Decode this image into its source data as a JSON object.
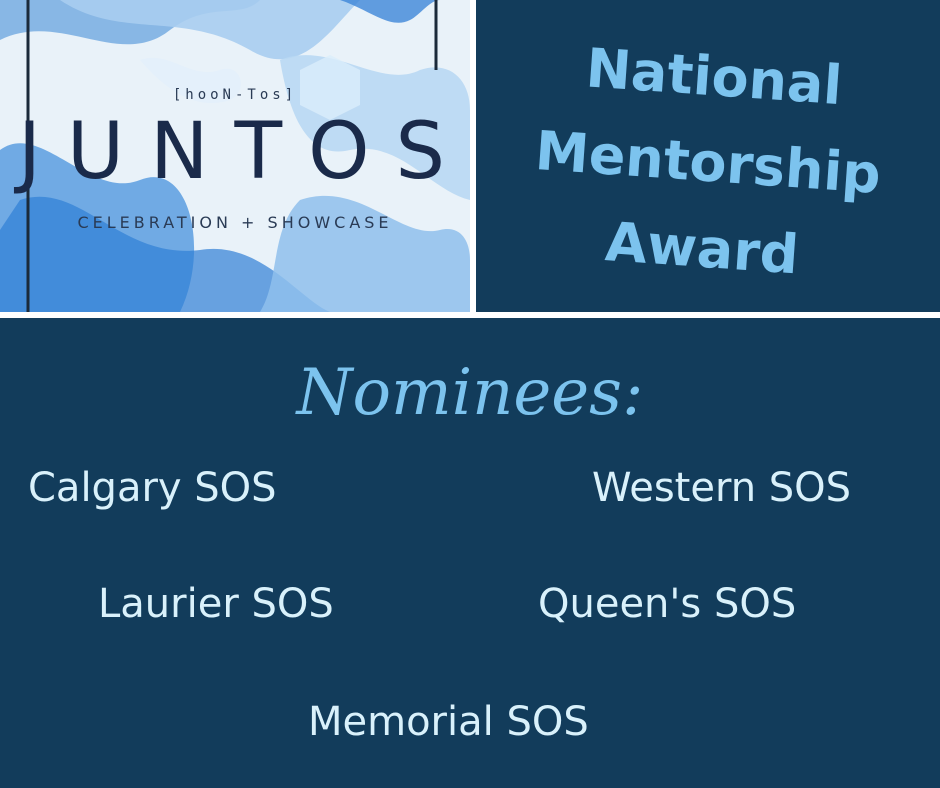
{
  "poster": {
    "subtitle": "[hooN-Tos]",
    "title": "JUNTOS",
    "tagline": "CELEBRATION + SHOWCASE"
  },
  "award": {
    "line1": "National",
    "line2": "Mentorship",
    "line3": "Award"
  },
  "nominees": {
    "heading": "Nominees:",
    "items": [
      "Calgary SOS",
      "Western SOS",
      "Laurier SOS",
      "Queen's SOS",
      "Memorial SOS"
    ]
  },
  "colors": {
    "navy": "#123c5b",
    "accent": "#7cc3ee",
    "text": "#d9f1fb"
  }
}
